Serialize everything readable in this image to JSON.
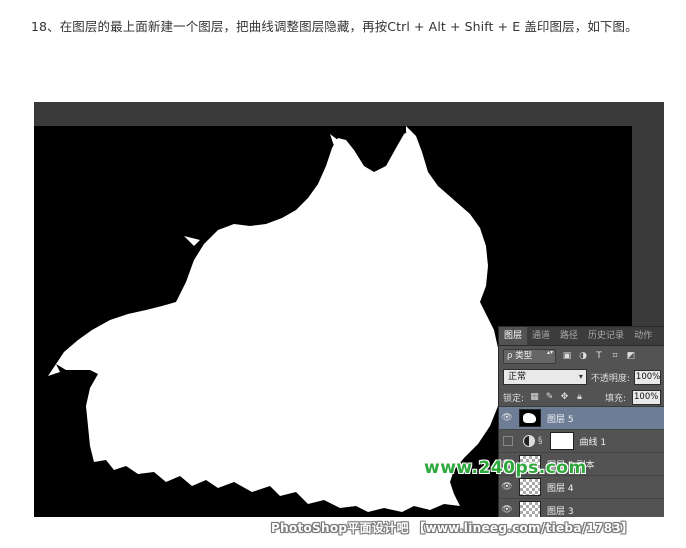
{
  "instruction_text": "18、在图层的最上面新建一个图层，把曲线调整图层隐藏，再按Ctrl + Alt + Shift + E 盖印图层，如下图。",
  "panel": {
    "tabs": [
      "图层",
      "通道",
      "路径",
      "历史记录",
      "动作"
    ],
    "kind_label": "ρ 类型",
    "filter_icons": [
      "image-filter-icon",
      "adjustment-filter-icon",
      "type-filter-icon",
      "shape-filter-icon",
      "smart-object-filter-icon"
    ],
    "blend_mode": "正常",
    "opacity_label": "不透明度:",
    "opacity_value": "100%",
    "lock_label": "锁定:",
    "fill_label": "填充:",
    "fill_value": "100%",
    "layers": [
      {
        "name": "图层 5",
        "thumb": "dog",
        "visible": true,
        "selected": true
      },
      {
        "name": "曲线 1",
        "thumb": "adjustment",
        "visible": false,
        "selected": false
      },
      {
        "name": "图层 5 副本",
        "thumb": "checker",
        "visible": true,
        "selected": false
      },
      {
        "name": "图层 4",
        "thumb": "checker",
        "visible": true,
        "selected": false
      },
      {
        "name": "图层 3",
        "thumb": "checker",
        "visible": true,
        "selected": false
      }
    ]
  },
  "watermark_site": "www.240ps.com",
  "footer_watermark": "PhotoShop平面设计吧 【www.lineeg.com/tieba/1783】"
}
